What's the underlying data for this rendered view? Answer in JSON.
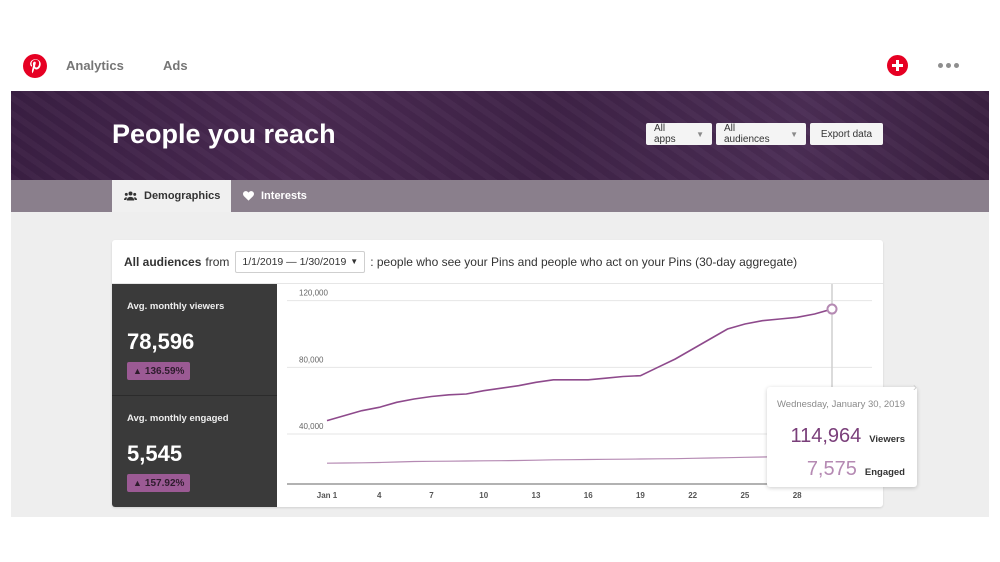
{
  "nav": {
    "analytics": "Analytics",
    "ads": "Ads"
  },
  "hero": {
    "title": "People you reach",
    "controls": {
      "apps": "All apps",
      "audiences": "All audiences",
      "export": "Export data"
    }
  },
  "tabs": {
    "demographics": "Demographics",
    "interests": "Interests"
  },
  "card": {
    "header_bold": "All audiences",
    "header_from": "from",
    "date_range": "1/1/2019 — 1/30/2019",
    "header_desc": ": people who see your Pins and people who act on your Pins (30-day aggregate)"
  },
  "stats": {
    "viewers": {
      "label": "Avg. monthly viewers",
      "value": "78,596",
      "change": "136.59%"
    },
    "engaged": {
      "label": "Avg. monthly engaged",
      "value": "5,545",
      "change": "157.92%"
    }
  },
  "tooltip": {
    "date": "Wednesday, January 30, 2019",
    "viewers_value": "114,964",
    "viewers_label": "Viewers",
    "engaged_value": "7,575",
    "engaged_label": "Engaged"
  },
  "colors": {
    "brand": "#e60023",
    "viewers_line": "#8e4a8c",
    "engaged_line": "#b58ab3",
    "hero_bg": "#3f2347"
  },
  "chart_data": {
    "type": "line",
    "y_ticks": [
      "40,000",
      "80,000",
      "120,000"
    ],
    "y_tick_values": [
      40000,
      80000,
      120000
    ],
    "ylim": [
      10000,
      130000
    ],
    "x_tick_labels": [
      "Jan 1",
      "4",
      "7",
      "10",
      "13",
      "16",
      "19",
      "22",
      "25",
      "28"
    ],
    "x_tick_days": [
      1,
      4,
      7,
      10,
      13,
      16,
      19,
      22,
      25,
      28
    ],
    "xlim": [
      1,
      30
    ],
    "x": [
      1,
      2,
      3,
      4,
      5,
      6,
      7,
      8,
      9,
      10,
      11,
      12,
      13,
      14,
      15,
      16,
      17,
      18,
      19,
      20,
      21,
      22,
      23,
      24,
      25,
      26,
      27,
      28,
      29,
      30
    ],
    "series": [
      {
        "name": "Viewers",
        "values": [
          48000,
          51000,
          54000,
          56000,
          59000,
          61000,
          62500,
          63500,
          64000,
          66000,
          67500,
          69000,
          71000,
          72500,
          72500,
          72500,
          73500,
          74500,
          75000,
          80000,
          85000,
          91000,
          97000,
          103000,
          106000,
          108000,
          109000,
          110000,
          112000,
          114964
        ]
      },
      {
        "name": "Engaged",
        "values": [
          22500,
          22600,
          22700,
          22900,
          23200,
          23500,
          23600,
          23700,
          23800,
          23900,
          24000,
          24100,
          24300,
          24500,
          24600,
          24700,
          24800,
          24900,
          25000,
          25100,
          25200,
          25400,
          25600,
          25800,
          26000,
          26200,
          26400,
          26600,
          26800,
          27000
        ]
      }
    ],
    "highlight_index": 29
  }
}
